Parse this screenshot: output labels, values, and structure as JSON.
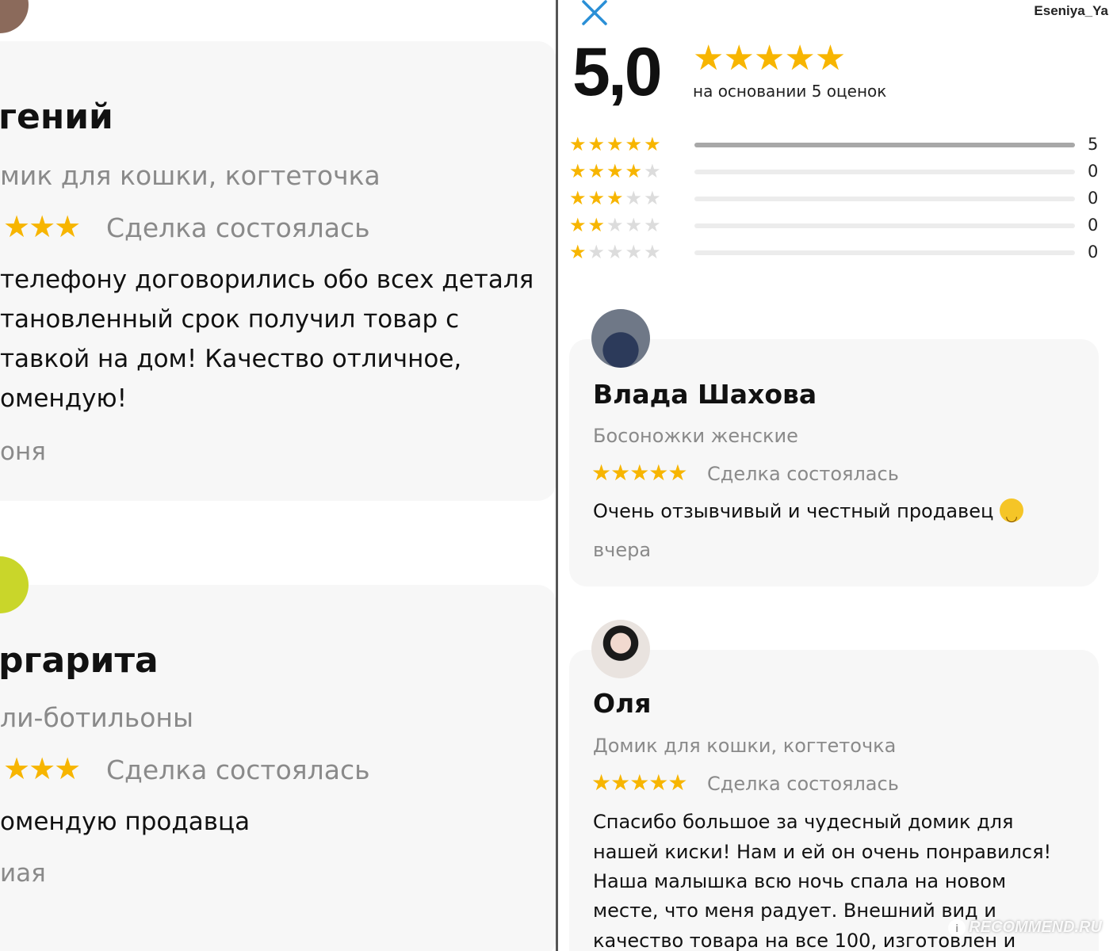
{
  "left": {
    "review1": {
      "name": "гений",
      "product": "мик для кошки, когтеточка",
      "stars": "★★★",
      "deal": "Сделка состоялась",
      "text": [
        "телефону договорились обо всех деталя",
        "тановленный срок получил товар с",
        "тавкой на дом! Качество отличное,",
        "омендую!"
      ],
      "date": "оня"
    },
    "review2": {
      "name": "ргарита",
      "product": "ли-ботильоны",
      "stars": "★★★",
      "deal": "Сделка состоялась",
      "text": "омендую продавца",
      "date": "иая"
    }
  },
  "right": {
    "close_icon": "close-icon",
    "username": "Eseniya_Ya",
    "rating": "5,0",
    "rating_stars": "★★★★★",
    "based_on": "на основании 5 оценок",
    "distribution": [
      {
        "stars": 5,
        "count": "5",
        "fraction": 1.0
      },
      {
        "stars": 4,
        "count": "0",
        "fraction": 0
      },
      {
        "stars": 3,
        "count": "0",
        "fraction": 0
      },
      {
        "stars": 2,
        "count": "0",
        "fraction": 0
      },
      {
        "stars": 1,
        "count": "0",
        "fraction": 0
      }
    ],
    "reviews": [
      {
        "name": "Влада Шахова",
        "product": "Босоножки женские",
        "stars": "★★★★★",
        "deal": "Сделка состоялась",
        "text": "Очень отзывчивый и честный продавец",
        "emoji": "smiling-face-emoji",
        "date": "вчера"
      },
      {
        "name": "Оля",
        "product": "Домик для кошки, когтеточка",
        "stars": "★★★★★",
        "deal": "Сделка состоялась",
        "text": [
          "Спасибо большое за чудесный домик для",
          "нашей киски! Нам и ей он очень понравился!",
          "Наша малышка всю ночь спала на новом",
          "месте, что меня радует. Внешний вид и",
          "качество  товара на все 100, изготовлен и"
        ]
      }
    ],
    "watermark": "RECOMMEND.RU"
  },
  "colors": {
    "star": "#f7b500",
    "muted": "#8a8a8a",
    "card": "#f7f7f7",
    "close": "#2a8fd6"
  }
}
